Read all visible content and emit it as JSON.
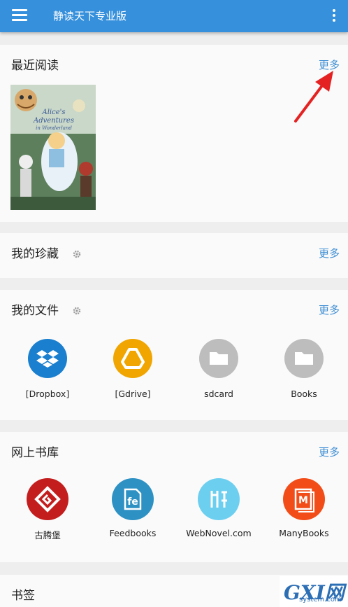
{
  "appbar": {
    "title": "静读天下专业版"
  },
  "recent": {
    "title": "最近阅读",
    "more": "更多",
    "book": {
      "title_line1": "Alice's",
      "title_line2": "Adventures",
      "title_line3": "in Wonderland"
    }
  },
  "favorites": {
    "title": "我的珍藏",
    "more": "更多"
  },
  "files": {
    "title": "我的文件",
    "more": "更多",
    "items": [
      {
        "label": "[Dropbox]",
        "icon": "dropbox-icon",
        "color": "#1a7fcf"
      },
      {
        "label": "[Gdrive]",
        "icon": "gdrive-icon",
        "color": "#f0a500"
      },
      {
        "label": "sdcard",
        "icon": "folder-icon",
        "color": "#bdbdbd"
      },
      {
        "label": "Books",
        "icon": "folder-icon",
        "color": "#bdbdbd"
      }
    ]
  },
  "library": {
    "title": "网上书库",
    "more": "更多",
    "items": [
      {
        "label": "古腾堡",
        "icon": "gutenberg-icon",
        "color": "#c31d1d"
      },
      {
        "label": "Feedbooks",
        "icon": "feedbooks-icon",
        "color": "#2d91c4"
      },
      {
        "label": "WebNovel.com",
        "icon": "webnovel-icon",
        "color": "#6dcff0"
      },
      {
        "label": "ManyBooks",
        "icon": "manybooks-icon",
        "color": "#f24d18"
      }
    ]
  },
  "bookmarks": {
    "title": "书签"
  },
  "watermark": {
    "text": "GXI网",
    "sub": "system.com"
  }
}
